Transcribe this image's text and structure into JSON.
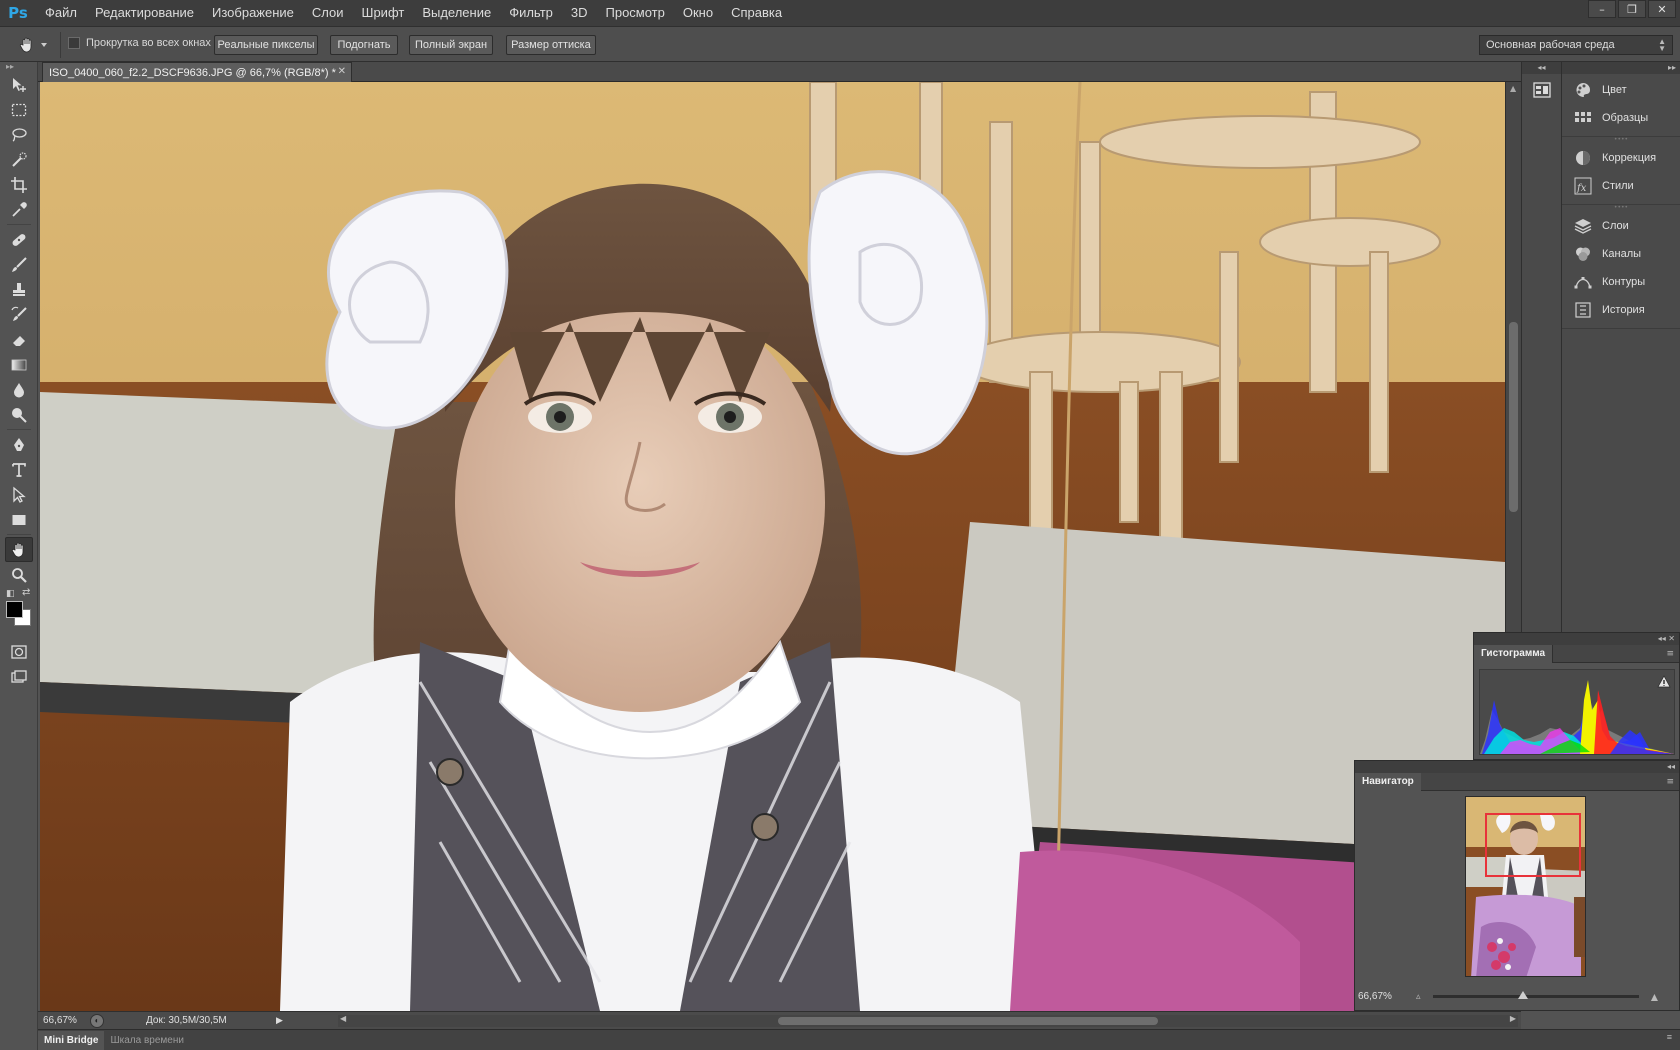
{
  "app": {
    "logo": "Ps",
    "menu": [
      "Файл",
      "Редактирование",
      "Изображение",
      "Слои",
      "Шрифт",
      "Выделение",
      "Фильтр",
      "3D",
      "Просмотр",
      "Окно",
      "Справка"
    ],
    "window_controls": {
      "minimize": "–",
      "restore": "❐",
      "close": "✕"
    }
  },
  "options_bar": {
    "tool_icon": "hand-icon",
    "scroll_all_label": "Прокрутка во всех окнах",
    "scroll_all_checked": false,
    "buttons": [
      "Реальные пикселы",
      "Подогнать",
      "Полный экран",
      "Размер оттиска"
    ],
    "workspace": "Основная рабочая среда"
  },
  "toolbar": {
    "tools": [
      {
        "name": "move-tool",
        "icon": "move-icon"
      },
      {
        "name": "marquee-tool",
        "icon": "marquee-icon"
      },
      {
        "name": "lasso-tool",
        "icon": "lasso-icon"
      },
      {
        "name": "quick-select-tool",
        "icon": "quick-select-icon"
      },
      {
        "name": "crop-tool",
        "icon": "crop-icon"
      },
      {
        "name": "eyedropper-tool",
        "icon": "eyedropper-icon"
      },
      {
        "name": "healing-tool",
        "icon": "bandage-icon"
      },
      {
        "name": "brush-tool",
        "icon": "brush-icon"
      },
      {
        "name": "stamp-tool",
        "icon": "stamp-icon"
      },
      {
        "name": "history-brush-tool",
        "icon": "history-brush-icon"
      },
      {
        "name": "eraser-tool",
        "icon": "eraser-icon"
      },
      {
        "name": "gradient-tool",
        "icon": "gradient-icon"
      },
      {
        "name": "blur-tool",
        "icon": "drop-icon"
      },
      {
        "name": "dodge-tool",
        "icon": "dodge-icon"
      },
      {
        "name": "pen-tool",
        "icon": "pen-icon"
      },
      {
        "name": "type-tool",
        "icon": "type-icon"
      },
      {
        "name": "path-select-tool",
        "icon": "arrow-icon"
      },
      {
        "name": "shape-tool",
        "icon": "rectangle-icon"
      },
      {
        "name": "hand-tool",
        "icon": "hand-icon",
        "active": true
      },
      {
        "name": "zoom-tool",
        "icon": "magnifier-icon"
      }
    ],
    "foreground": "#000000",
    "background": "#ffffff"
  },
  "document": {
    "tab_title": "ISO_0400_060_f2.2_DSCF9636.JPG @ 66,7% (RGB/8*) *",
    "zoom": "66,67%",
    "doc_size": "Док: 30,5M/30,5M"
  },
  "bottom_tabs": [
    {
      "label": "Mini Bridge",
      "active": true
    },
    {
      "label": "Шкала времени",
      "active": false
    }
  ],
  "right_dock": {
    "groups": [
      [
        {
          "label": "Цвет",
          "icon": "palette-icon"
        },
        {
          "label": "Образцы",
          "icon": "swatches-grid-icon"
        }
      ],
      [
        {
          "label": "Коррекция",
          "icon": "adjustment-circle-icon"
        },
        {
          "label": "Стили",
          "icon": "fx-icon"
        }
      ],
      [
        {
          "label": "Слои",
          "icon": "layers-icon"
        },
        {
          "label": "Каналы",
          "icon": "channels-icon"
        },
        {
          "label": "Контуры",
          "icon": "paths-icon"
        },
        {
          "label": "История",
          "icon": "history-icon"
        }
      ]
    ]
  },
  "histogram": {
    "title": "Гистограмма",
    "warning_icon": "warning-triangle-icon"
  },
  "navigator": {
    "title": "Навигатор",
    "zoom": "66,67%",
    "zoom_slider_fraction": 0.44
  },
  "colors": {
    "ps_blue": "#2fa7e6",
    "nav_view_box": "#e8323a",
    "ui_dark": "#3d3d3d",
    "ui_mid": "#535353"
  }
}
